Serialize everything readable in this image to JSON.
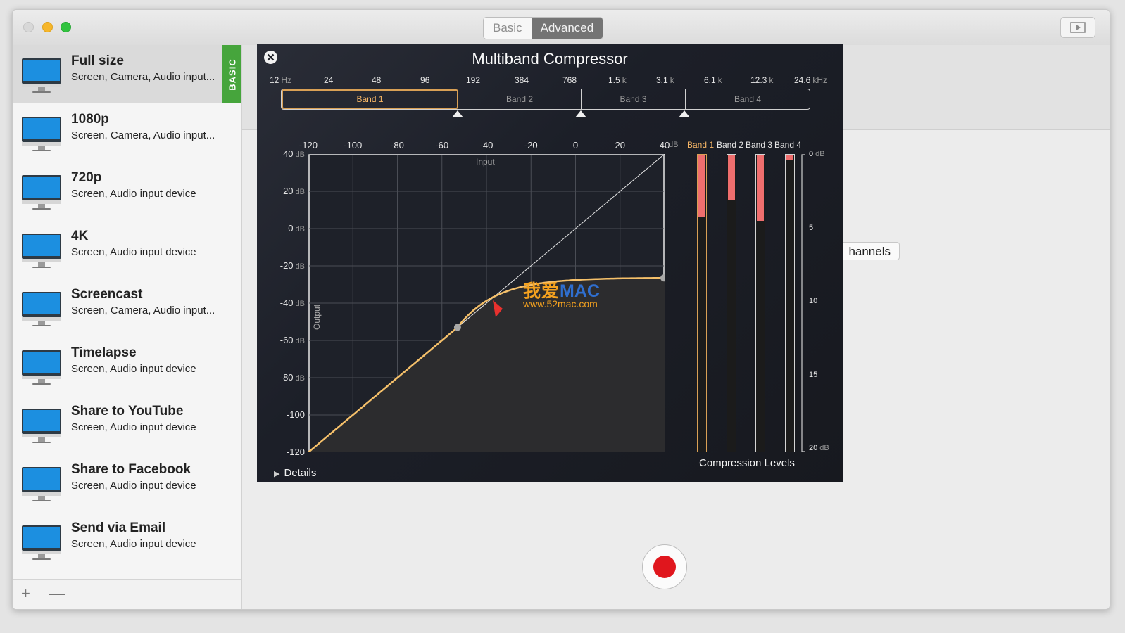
{
  "toolbar": {
    "mode_basic": "Basic",
    "mode_advanced": "Advanced",
    "preview_icon": "play-window-icon"
  },
  "sidebar": {
    "presets": [
      {
        "name": "Full size",
        "desc": "Screen, Camera, Audio input...",
        "tag": "BASIC"
      },
      {
        "name": "1080p",
        "desc": "Screen, Camera, Audio input..."
      },
      {
        "name": "720p",
        "desc": "Screen, Audio input device"
      },
      {
        "name": "4K",
        "desc": "Screen, Audio input device"
      },
      {
        "name": "Screencast",
        "desc": "Screen, Camera, Audio input..."
      },
      {
        "name": "Timelapse",
        "desc": "Screen, Audio input device"
      },
      {
        "name": "Share to YouTube",
        "desc": "Screen, Audio input device"
      },
      {
        "name": "Share to Facebook",
        "desc": "Screen, Audio input device"
      },
      {
        "name": "Send via Email",
        "desc": "Screen, Audio input device"
      }
    ],
    "add_label": "+",
    "remove_label": "—"
  },
  "content": {
    "channels_label": "hannels"
  },
  "compressor": {
    "title": "Multiband Compressor",
    "freq_labels": [
      "12",
      "24",
      "48",
      "96",
      "192",
      "384",
      "768",
      "1.5",
      "3.1",
      "6.1",
      "12.3",
      "24.6"
    ],
    "freq_units": {
      "first": "Hz",
      "k": "k",
      "last": "kHz"
    },
    "bands": [
      "Band 1",
      "Band 2",
      "Band 3",
      "Band 4"
    ],
    "input_ticks": [
      "-120",
      "-100",
      "-80",
      "-60",
      "-40",
      "-20",
      "0",
      "20",
      "40"
    ],
    "input_unit": "dB",
    "output_ticks": [
      "40",
      "20",
      "0",
      "-20",
      "-40",
      "-60",
      "-80",
      "-100",
      "-120"
    ],
    "output_unit": "dB",
    "input_label": "Input",
    "output_label": "Output",
    "curve_color": "#f5c06a",
    "meter_fill_color": "#ef6e6e",
    "meter_scale": [
      "0",
      "5",
      "10",
      "15",
      "20"
    ],
    "meter_scale_unit": "dB",
    "compression_levels_db": [
      4.1,
      3.0,
      4.4,
      0.3
    ],
    "compression_title": "Compression Levels",
    "details_label": "Details"
  },
  "watermark": {
    "cn": "我爱",
    "mac": "MAC",
    "url": "www.52mac.com"
  }
}
